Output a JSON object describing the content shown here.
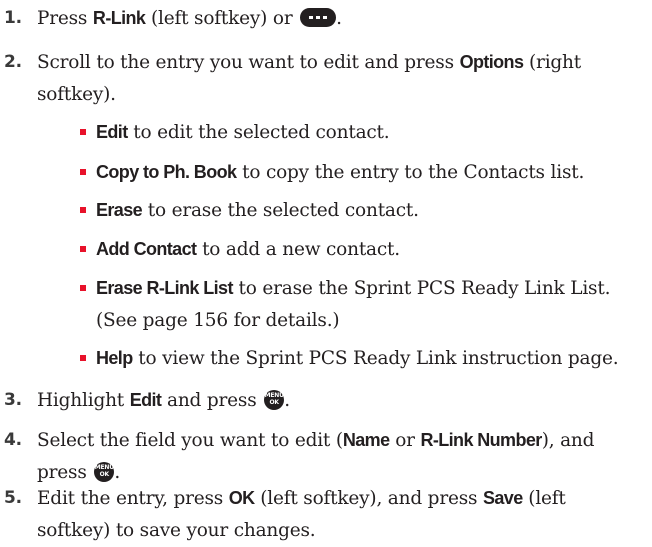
{
  "colors": {
    "text": "#231f20",
    "step_number": "#3a3a3a",
    "bullet_marker": "#e8122a",
    "icon_fill": "#231f20"
  },
  "icons": {
    "softkey_button": "three-dot-softkey-icon",
    "menu_ok_button": "menu-ok-key-icon",
    "menu_ok_top": "MENU",
    "menu_ok_bottom": "OK"
  },
  "steps": [
    {
      "number": "1.",
      "parts": [
        "Press ",
        "R-Link",
        " (left softkey) or ",
        "."
      ]
    },
    {
      "number": "2.",
      "line1": [
        "Scroll to the entry you want to edit and press ",
        "Options",
        " (right"
      ],
      "line2": "softkey)."
    },
    {
      "number": "3.",
      "parts": [
        "Highlight ",
        "Edit",
        " and press ",
        "."
      ]
    },
    {
      "number": "4.",
      "line1": [
        "Select the field you want to edit (",
        "Name",
        " or ",
        "R-Link Number",
        "), and"
      ],
      "line2": "press "
    },
    {
      "number": "5.",
      "line1": [
        "Edit the entry, press ",
        "OK",
        " (left softkey), and press ",
        "Save",
        " (left"
      ],
      "line2": "softkey) to save your changes."
    }
  ],
  "options": [
    {
      "bold": "Edit",
      "text": " to edit the selected contact."
    },
    {
      "bold": "Copy to Ph. Book",
      "text": " to copy the entry to the Contacts list."
    },
    {
      "bold": "Erase",
      "text": " to erase the selected contact."
    },
    {
      "bold": "Add Contact",
      "text": " to add a new contact."
    },
    {
      "bold": "Erase R-Link List",
      "text": " to erase the Sprint PCS Ready Link List.",
      "line2": "(See page 156 for details.)"
    },
    {
      "bold": "Help",
      "text": " to view the Sprint PCS Ready Link instruction page."
    }
  ]
}
